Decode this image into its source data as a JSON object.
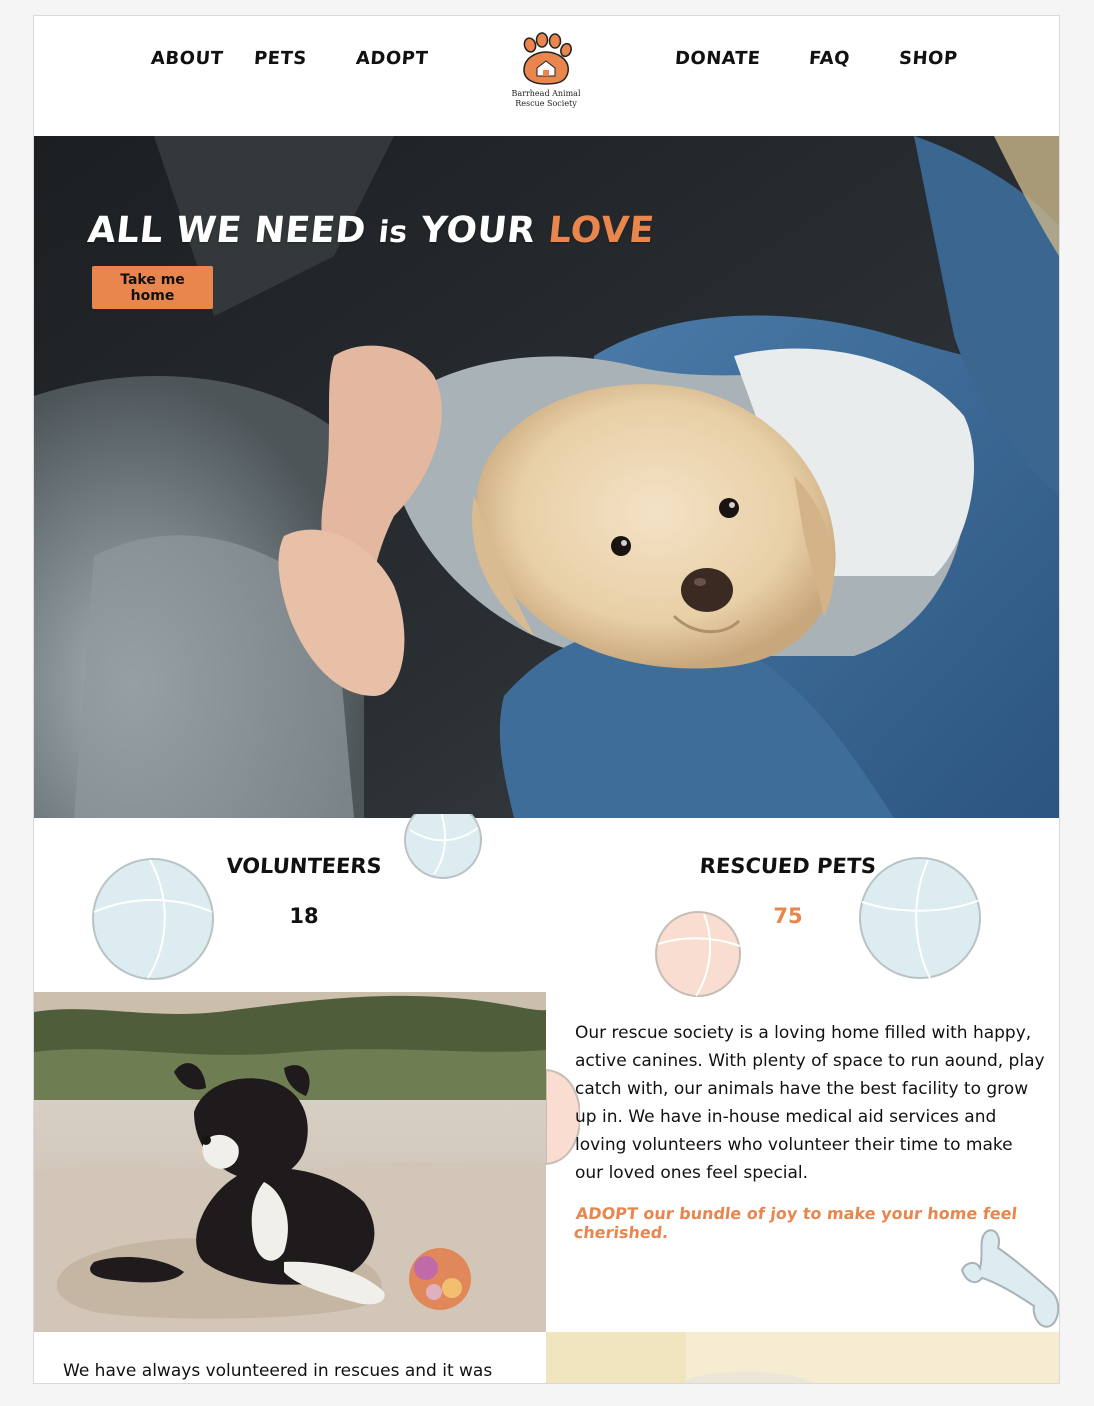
{
  "nav": {
    "left": [
      {
        "label": "ABOUT"
      },
      {
        "label": "PETS"
      },
      {
        "label": "ADOPT"
      }
    ],
    "right": [
      {
        "label": "DONATE"
      },
      {
        "label": "FAQ"
      },
      {
        "label": "SHOP"
      }
    ],
    "logo_line1": "Barrhead Animal",
    "logo_line2": "Rescue Society"
  },
  "hero": {
    "title_part1": "ALL WE NEED ",
    "title_part2": "is",
    "title_part3": " YOUR ",
    "title_accent": "LOVE",
    "button_label": "Take me home"
  },
  "stats": {
    "volunteers_label": "VOLUNTEERS",
    "volunteers_value": "18",
    "rescued_label": "RESCUED PETS",
    "rescued_value": "75"
  },
  "about": {
    "paragraph": "Our rescue society is a loving home filled with happy, active canines. With plenty of space to run aound, play catch with, our animals have the best facility to grow up in. We have in-house medical aid services and loving volunteers who volunteer their time to make our loved ones feel special.",
    "cta": "ADOPT our bundle of joy to make your home feel cherished.",
    "bottom_text": "We have always volunteered in rescues and it was"
  },
  "colors": {
    "accent": "#e8864e",
    "ball_blue": "#dcecf0",
    "ball_peach": "#f8ddd0"
  }
}
